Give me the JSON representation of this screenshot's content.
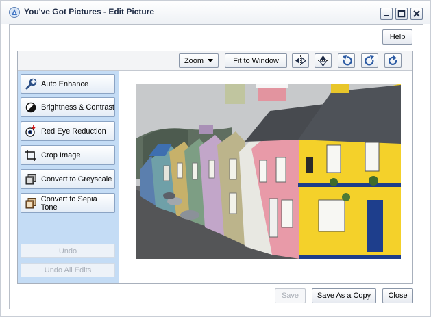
{
  "window": {
    "title": "You've Got Pictures - Edit Picture",
    "icon": "aol-triangle-icon",
    "controls": {
      "minimize": "minimize-icon",
      "maximize": "maximize-icon",
      "close": "close-icon"
    }
  },
  "header": {
    "help_label": "Help"
  },
  "toolbar": {
    "zoom_label": "Zoom",
    "fit_label": "Fit to Window",
    "icon_buttons": [
      "flip-horizontal-icon",
      "flip-vertical-icon",
      "rotate-left-icon",
      "rotate-right-icon",
      "rotate-180-icon"
    ]
  },
  "tools": [
    {
      "label": "Auto Enhance",
      "icon": "wrench-icon"
    },
    {
      "label": "Brightness & Contrast",
      "icon": "contrast-icon"
    },
    {
      "label": "Red Eye Reduction",
      "icon": "red-eye-icon"
    },
    {
      "label": "Crop Image",
      "icon": "crop-icon"
    },
    {
      "label": "Convert to Greyscale",
      "icon": "greyscale-icon"
    },
    {
      "label": "Convert to Sepia Tone",
      "icon": "sepia-icon"
    }
  ],
  "undo": {
    "undo_label": "Undo",
    "undo_all_label": "Undo All Edits"
  },
  "footer": {
    "save_label": "Save",
    "save_copy_label": "Save As a Copy",
    "close_label": "Close"
  },
  "colors": {
    "sidebar_bg": "#c4dcf5",
    "title_text": "#1d2a44",
    "disabled_text": "#a9aeb6"
  }
}
